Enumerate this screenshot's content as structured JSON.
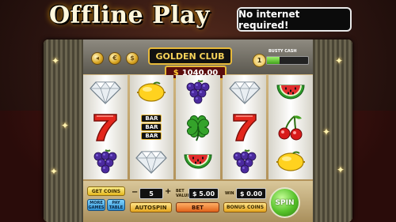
{
  "promo": {
    "title": "Offline Play",
    "badge": "No internet required!"
  },
  "header": {
    "club_name": "GOLDEN CLUB",
    "balance_currency": "$",
    "balance_value": "1040.00",
    "busty_cash_label": "BUSTY CASH",
    "level": "1",
    "progress_fraction": 0.3
  },
  "reels": [
    [
      "diamond",
      "seven",
      "grapes"
    ],
    [
      "lemon",
      "triple-bar",
      "diamond"
    ],
    [
      "grapes",
      "clover",
      "watermelon"
    ],
    [
      "diamond",
      "seven",
      "grapes"
    ],
    [
      "watermelon",
      "cherries",
      "lemon"
    ]
  ],
  "bar_symbol": {
    "line1": "BAR",
    "line2": "BAR",
    "line3": "BAR"
  },
  "controls": {
    "get_coins": "GET COINS",
    "more_games": "MORE GAMES",
    "pay_table": "PAY TABLE",
    "minus": "−",
    "plus": "+",
    "lines_value": "5",
    "autospin": "AUTOSPIN",
    "bet_value_label": "BET VALUE",
    "bet_value": "$ 5.00",
    "bet": "BET",
    "win_label": "WIN",
    "win_value": "$ 0.00",
    "bonus_coins": "BONUS COINS",
    "spin": "SPIN"
  },
  "colors": {
    "gold": "#e7b93a",
    "spin_green": "#56c22a",
    "bet_orange": "#e0621a"
  }
}
